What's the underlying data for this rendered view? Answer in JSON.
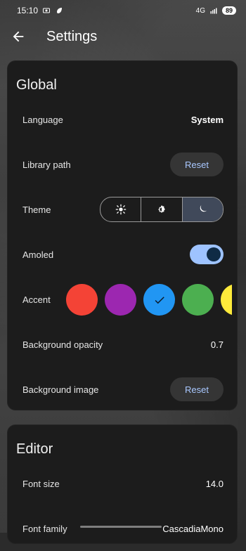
{
  "status_bar": {
    "time": "15:10",
    "network": "4G",
    "battery": "89"
  },
  "app_bar": {
    "title": "Settings"
  },
  "sections": {
    "global": {
      "title": "Global",
      "language_label": "Language",
      "language_value": "System",
      "library_path_label": "Library path",
      "library_path_button": "Reset",
      "theme_label": "Theme",
      "theme_options": [
        "light",
        "auto",
        "dark"
      ],
      "theme_selected": "dark",
      "amoled_label": "Amoled",
      "amoled_enabled": true,
      "accent_label": "Accent",
      "accent_colors": [
        "#F44336",
        "#9C27B0",
        "#2196F3",
        "#4CAF50",
        "#FFEB3B"
      ],
      "accent_selected": "#2196F3",
      "background_opacity_label": "Background opacity",
      "background_opacity_value": "0.7",
      "background_image_label": "Background image",
      "background_image_button": "Reset"
    },
    "editor": {
      "title": "Editor",
      "font_size_label": "Font size",
      "font_size_value": "14.0",
      "font_family_label": "Font family",
      "font_family_value": "CascadiaMono"
    }
  },
  "icons": {
    "back": "arrow-left-icon",
    "theme_light": "sun-icon",
    "theme_auto": "brightness-auto-icon",
    "theme_dark": "moon-icon",
    "check": "check-icon"
  }
}
